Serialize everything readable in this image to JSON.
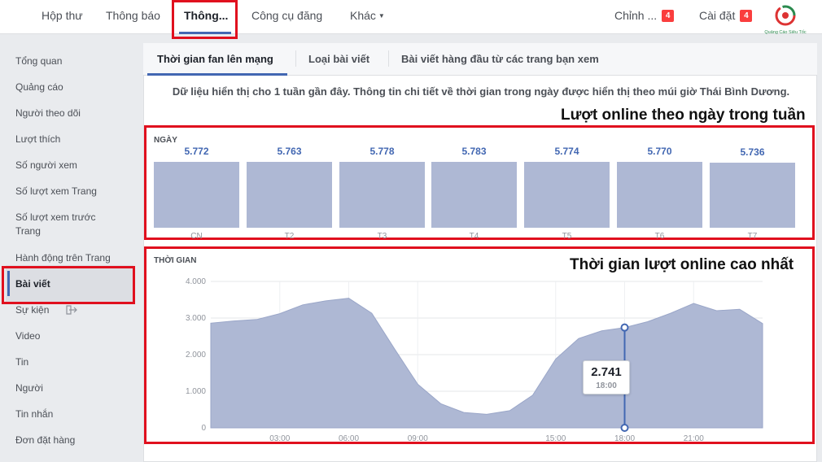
{
  "nav": {
    "items": [
      "Hộp thư",
      "Thông báo",
      "Thông...",
      "Công cụ đăng",
      "Khác"
    ],
    "edit_label": "Chỉnh ...",
    "edit_badge": "4",
    "settings_label": "Cài đặt",
    "settings_badge": "4",
    "logo_text": "Quảng Cáo Siêu Tốc"
  },
  "sidebar": {
    "items": [
      "Tổng quan",
      "Quảng cáo",
      "Người theo dõi",
      "Lượt thích",
      "Số người xem",
      "Số lượt xem Trang",
      "Số lượt xem trước Trang",
      "Hành động trên Trang",
      "Bài viết",
      "Sự kiện",
      "Video",
      "Tin",
      "Người",
      "Tin nhắn",
      "Đơn đặt hàng"
    ],
    "active": "Bài viết"
  },
  "tabs": [
    "Thời gian fan lên mạng",
    "Loại bài viết",
    "Bài viết hàng đầu từ các trang bạn xem"
  ],
  "info_text": "Dữ liệu hiển thị cho 1 tuần gần đây. Thông tin chi tiết về thời gian trong ngày được hiển thị theo múi giờ Thái Bình Dương.",
  "annotations": {
    "days": "Lượt online theo ngày trong tuần",
    "time": "Thời gian lượt online cao nhất"
  },
  "tooltip": {
    "value": "2.741",
    "time": "18:00"
  },
  "colors": {
    "accent": "#4267b2",
    "fill": "#aeb8d4",
    "annotation": "#e0101e"
  },
  "chart_data": [
    {
      "type": "bar",
      "label": "NGÀY",
      "categories": [
        "CN",
        "T2",
        "T3",
        "T4",
        "T5",
        "T6",
        "T7"
      ],
      "value_labels": [
        "5.772",
        "5.763",
        "5.778",
        "5.783",
        "5.774",
        "5.770",
        "5.736"
      ],
      "values": [
        5772,
        5763,
        5778,
        5783,
        5774,
        5770,
        5736
      ]
    },
    {
      "type": "area",
      "label": "THỜI GIAN",
      "x": [
        0,
        1,
        2,
        3,
        4,
        5,
        6,
        7,
        8,
        9,
        10,
        11,
        12,
        13,
        14,
        15,
        16,
        17,
        18,
        19,
        20,
        21,
        22,
        23
      ],
      "values": [
        2860,
        2920,
        2960,
        3120,
        3360,
        3470,
        3540,
        3130,
        2150,
        1190,
        660,
        420,
        370,
        470,
        890,
        1880,
        2440,
        2650,
        2741,
        2900,
        3130,
        3400,
        3200,
        3240
      ],
      "end_value": 2850,
      "xticks": [
        "03:00",
        "06:00",
        "09:00",
        "15:00",
        "18:00",
        "21:00"
      ],
      "xtick_positions": [
        3,
        6,
        9,
        15,
        18,
        21
      ],
      "yticks": [
        "4.000",
        "3.000",
        "2.000",
        "1.000",
        "0"
      ],
      "ylim": [
        0,
        4000
      ],
      "highlight_x": 18
    }
  ]
}
